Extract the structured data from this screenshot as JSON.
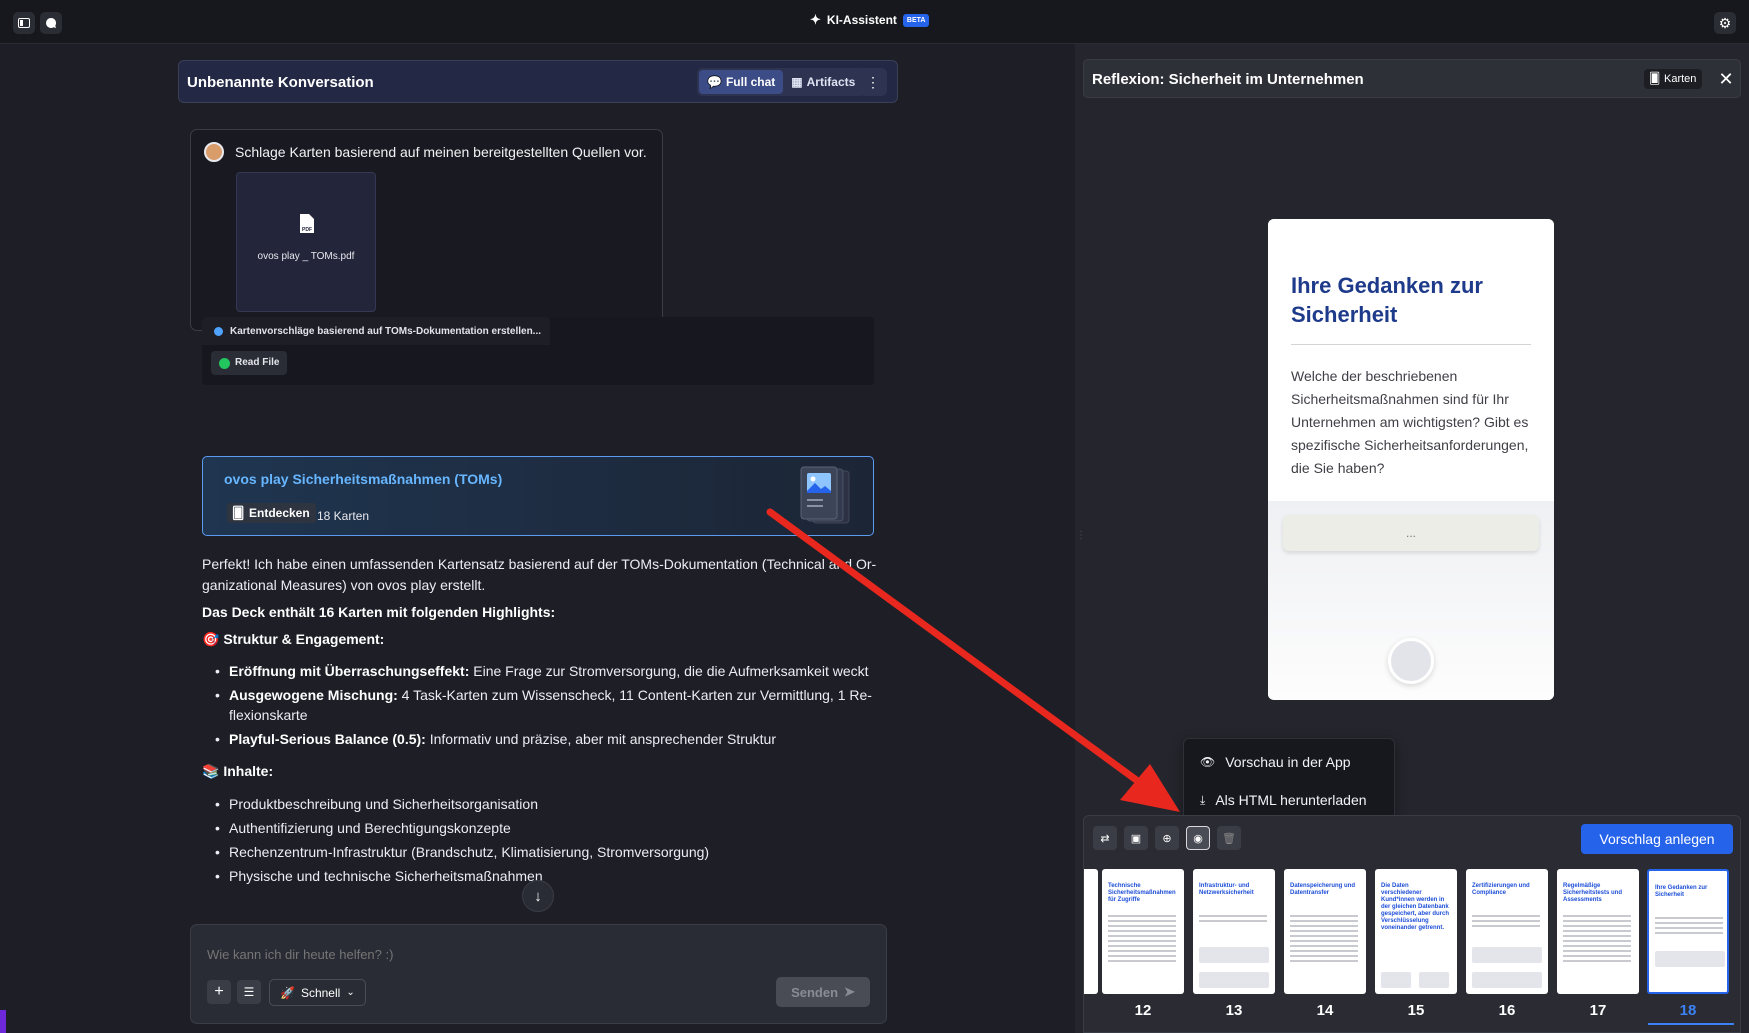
{
  "topbar": {
    "title": "KI-Assistent",
    "badge": "BETA"
  },
  "conversation": {
    "title": "Unbenannte Konversation",
    "tabs": [
      {
        "label": "Full chat",
        "active": true
      },
      {
        "label": "Artifacts",
        "active": false
      }
    ]
  },
  "user_message": {
    "text": "Schlage Karten basierend auf meinen bereitgestellten Quellen vor.",
    "attachment": "ovos play _ TOMs.pdf"
  },
  "tool": {
    "status": "Kartenvorschläge basierend auf TOMs-Dokumentation erstellen...",
    "chip": "Read File"
  },
  "deck": {
    "title": "ovos play Sicherheitsmaßnahmen (TOMs)",
    "action": "Entdecken",
    "count": "18 Karten"
  },
  "answer": {
    "intro_1": "Perfekt! Ich habe einen umfassenden Kartensatz basierend auf der TOMs-Dokumentation (Technical and Or-",
    "intro_2": "ganizational Measures) von ovos play erstellt.",
    "deck_info": "Das Deck enthält 16 Karten mit folgenden Highlights:",
    "section1": "🎯 Struktur & Engagement:",
    "b1_bold": "Eröffnung mit Überraschungseffekt:",
    "b1_text": " Eine Frage zur Stromversorgung, die die Aufmerksamkeit weckt",
    "b2_bold": "Ausgewogene Mischung:",
    "b2_text": " 4 Task-Karten zum Wissenscheck, 11 Content-Karten zur Vermittlung, 1 Re-",
    "b2_cont": "flexionskarte",
    "b3_bold": "Playful-Serious Balance (0.5):",
    "b3_text": " Informativ und präzise, aber mit ansprechender Struktur",
    "section2": "📚 Inhalte:",
    "c1": "Produktbeschreibung und Sicherheitsorganisation",
    "c2": "Authentifizierung und Berechtigungskonzepte",
    "c3": "Rechenzentrum-Infrastruktur (Brandschutz, Klimatisierung, Stromversorgung)",
    "c4": "Physische und technische Sicherheitsmaßnahmen"
  },
  "composer": {
    "placeholder": "Wie kann ich dir heute helfen? :)",
    "mode": "Schnell",
    "send": "Senden"
  },
  "right_panel": {
    "title": "Reflexion: Sicherheit im Unternehmen",
    "chip": "Karten",
    "card_title": "Ihre Gedanken zur Sicherheit",
    "card_text": "Welche der beschriebenen Sicherheitsmaßnahmen sind für Ihr Unternehmen am wichtigsten? Gibt es spezifische Sicherheitsanforderungen, die Sie haben?",
    "card_field": "..."
  },
  "menu": {
    "preview": "Vorschau in der App",
    "download": "Als HTML herunterladen"
  },
  "toolbar": {
    "create": "Vorschlag anlegen"
  },
  "thumbnails": [
    {
      "num": "12",
      "title": "Technische Sicherheitsmaßnahmen für Zugriffe"
    },
    {
      "num": "13",
      "title": "Infrastruktur- und Netzwerksicherheit"
    },
    {
      "num": "14",
      "title": "Datenspeicherung und Datentransfer"
    },
    {
      "num": "15",
      "title": "Die Daten verschiedener Kund*innen werden in der gleichen Datenbank gespeichert, aber durch Verschlüsselung voneinander getrennt."
    },
    {
      "num": "16",
      "title": "Zertifizierungen und Compliance"
    },
    {
      "num": "17",
      "title": "Regelmäßige Sicherheitstests und Assessments"
    },
    {
      "num": "18",
      "title": "Ihre Gedanken zur Sicherheit"
    }
  ],
  "colors": {
    "accent": "#2563eb",
    "deck_title": "#67b6ff",
    "card_title": "#1e3a8a",
    "annotation_arrow": "#e8281e"
  }
}
